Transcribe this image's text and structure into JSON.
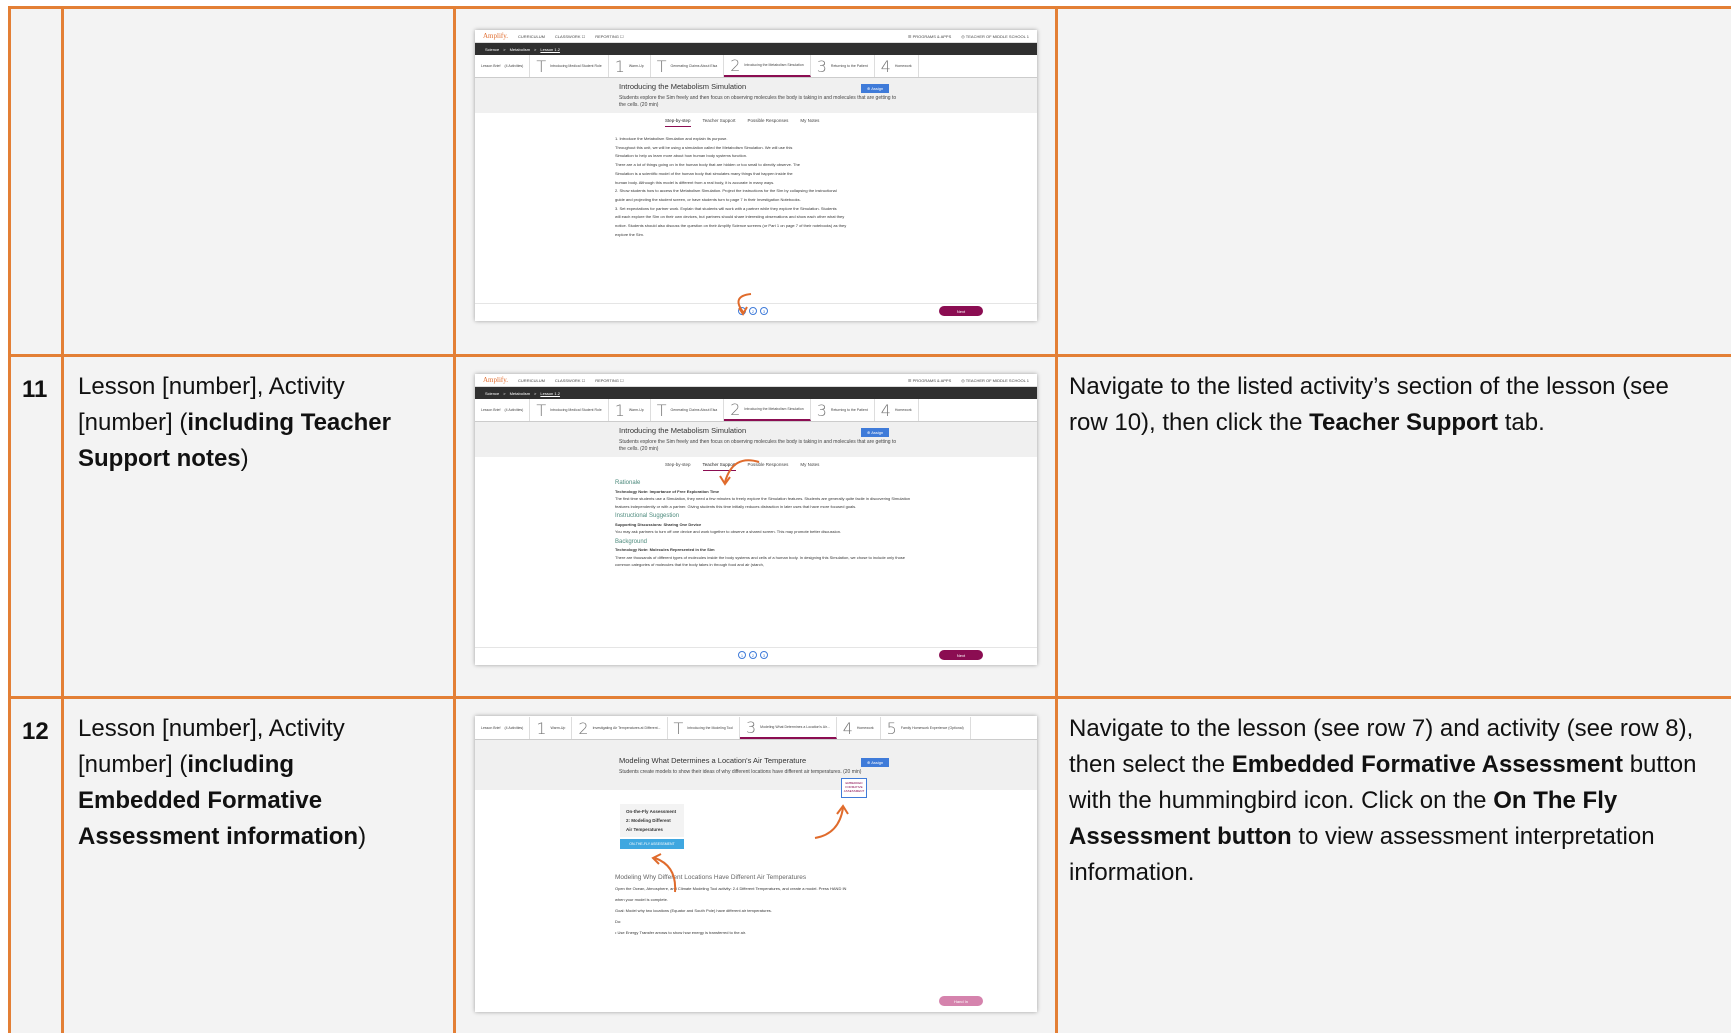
{
  "rows": [
    {
      "num": "",
      "desc": "",
      "instr": ""
    },
    {
      "num": "11",
      "desc_parts": [
        "Lesson [number], Activity [number] (",
        "including Teacher Support notes",
        ")"
      ],
      "instr_parts": [
        "Navigate to the listed activity’s section of the lesson (see row 10), then click the ",
        "Teacher Support",
        " tab."
      ]
    },
    {
      "num": "12",
      "desc_parts": [
        "Lesson [number], Activity [number] (",
        "including Embedded Formative Assessment information",
        ")"
      ],
      "instr_parts": [
        "Navigate to the lesson (see row 7) and activity (see row 8), then select the ",
        "Embedded Formative Assessment",
        " button with the hummingbird icon. Click on the ",
        "On The Fly Assessment button",
        " to view assessment interpretation information."
      ]
    }
  ],
  "app": {
    "logo": "Amplify.",
    "nav": [
      "CURRICULUM",
      "CLASSWORK ☐",
      "REPORTING ☐"
    ],
    "nav_right": [
      "☰ PROGRAMS & APPS",
      "◎ TEACHER OF MIDDLE SCHOOL 1"
    ],
    "crumb": [
      "Science",
      ">",
      "Metabolism",
      ">",
      "Lesson 1.2"
    ],
    "activities": [
      {
        "n": "Lesson Brief",
        "t": "(4 Activities)"
      },
      {
        "n": "T",
        "t": "Introducing Medical Student Role"
      },
      {
        "n": "1",
        "t": "Warm-Up"
      },
      {
        "n": "T",
        "t": "Generating Claims About Elsa"
      },
      {
        "n": "2",
        "t": "Introducing the Metabolism Simulation"
      },
      {
        "n": "3",
        "t": "Returning to the Patient"
      },
      {
        "n": "4",
        "t": "Homework"
      }
    ],
    "title": "Introducing the Metabolism Simulation",
    "assign": "⊕ Assign",
    "subtitle": "Students explore the Sim freely and then focus on observing molecules the body is taking in and molecules that are getting to the cells. (20 min)",
    "tabs": [
      "Step-by-step",
      "Teacher Support",
      "Possible Responses",
      "My Notes"
    ],
    "next": "Next"
  },
  "shot1": {
    "lines": [
      "1. Introduce the Metabolism Simulation and explain its purpose.",
      "Throughout this unit, we will be using a simulation called the Metabolism Simulation. We will use this",
      "Simulation to help us learn more about how human body systems function.",
      "There are a lot of things going on in the human body that are hidden or too small to directly observe. The",
      "Simulation is a scientific model of the human body that simulates many things that happen inside the",
      "human body. Although this model is different from a real body, it is accurate in many ways.",
      "2. Show students how to access the Metabolism Simulation. Project the instructions for the Sim by collapsing the instructional",
      "guide and projecting the student screen, or have students turn to page 7 in their Investigation Notebooks.",
      "3. Set expectations for partner work. Explain that students will work with a partner while they explore the Simulation. Students",
      "will each explore the Sim on their own devices, but partners should share interesting observations and show each other what they",
      "notice. Students should also discuss the question on their Amplify Science screens (or Part 1 on page 7 of their notebooks) as they",
      "explore the Sim."
    ]
  },
  "shot2": {
    "sections": [
      {
        "h": "Rationale",
        "s": "Technology Note: Importance of Free Exploration Time",
        "t": "The first time students use a Simulation, they need a few minutes to freely explore the Simulation features. Students are generally quite facile in discovering Simulation features independently or with a partner. Giving students this time initially reduces distraction in later uses that have more focused goals."
      },
      {
        "h": "Instructional Suggestion",
        "s": "Supporting Discussions: Sharing One Device",
        "t": "You may ask partners to turn off one device and work together to observe a shared screen. This may promote better discussion."
      },
      {
        "h": "Background",
        "s": "Technology Note: Molecules Represented in the Sim",
        "t": "There are thousands of different types of molecules inside the body systems and cells of a human body. In designing this Simulation, we chose to include only those common categories of molecules that the body takes in through food and air (starch,"
      }
    ]
  },
  "shot3": {
    "activities": [
      {
        "n": "Lesson Brief",
        "t": "(4 Activities)"
      },
      {
        "n": "1",
        "t": "Warm-Up"
      },
      {
        "n": "2",
        "t": "Investigating Air Temperatures at Different..."
      },
      {
        "n": "T",
        "t": "Introducing the Modeling Tool"
      },
      {
        "n": "3",
        "t": "Modeling What Determines a Location's Air..."
      },
      {
        "n": "4",
        "t": "Homework"
      },
      {
        "n": "5",
        "t": "Family Homework Experience (Optional)"
      }
    ],
    "title": "Modeling What Determines a Location's Air Temperature",
    "subtitle": "Students create models to show their ideas of why different locations have different air temperatures. (20 min)",
    "otf": "On-the-Fly Assessment 2: Modeling Different Air Temperatures",
    "otf_btn": "ON-THE-FLY ASSESSMENT",
    "sec": "Modeling Why Different Locations Have Different Air Temperatures",
    "lines": [
      "Open the Ocean, Atmosphere, and Climate Modeling Tool activity: 2.4 Different Temperatures, and create a model. Press HAND IN",
      "when your model is complete.",
      "Goal: Model why two locations (Equator and South Pole) have different air temperatures.",
      "Do:",
      "• Use Energy Transfer arrows to show how energy is transferred to the air."
    ],
    "handin": "Hand In"
  }
}
